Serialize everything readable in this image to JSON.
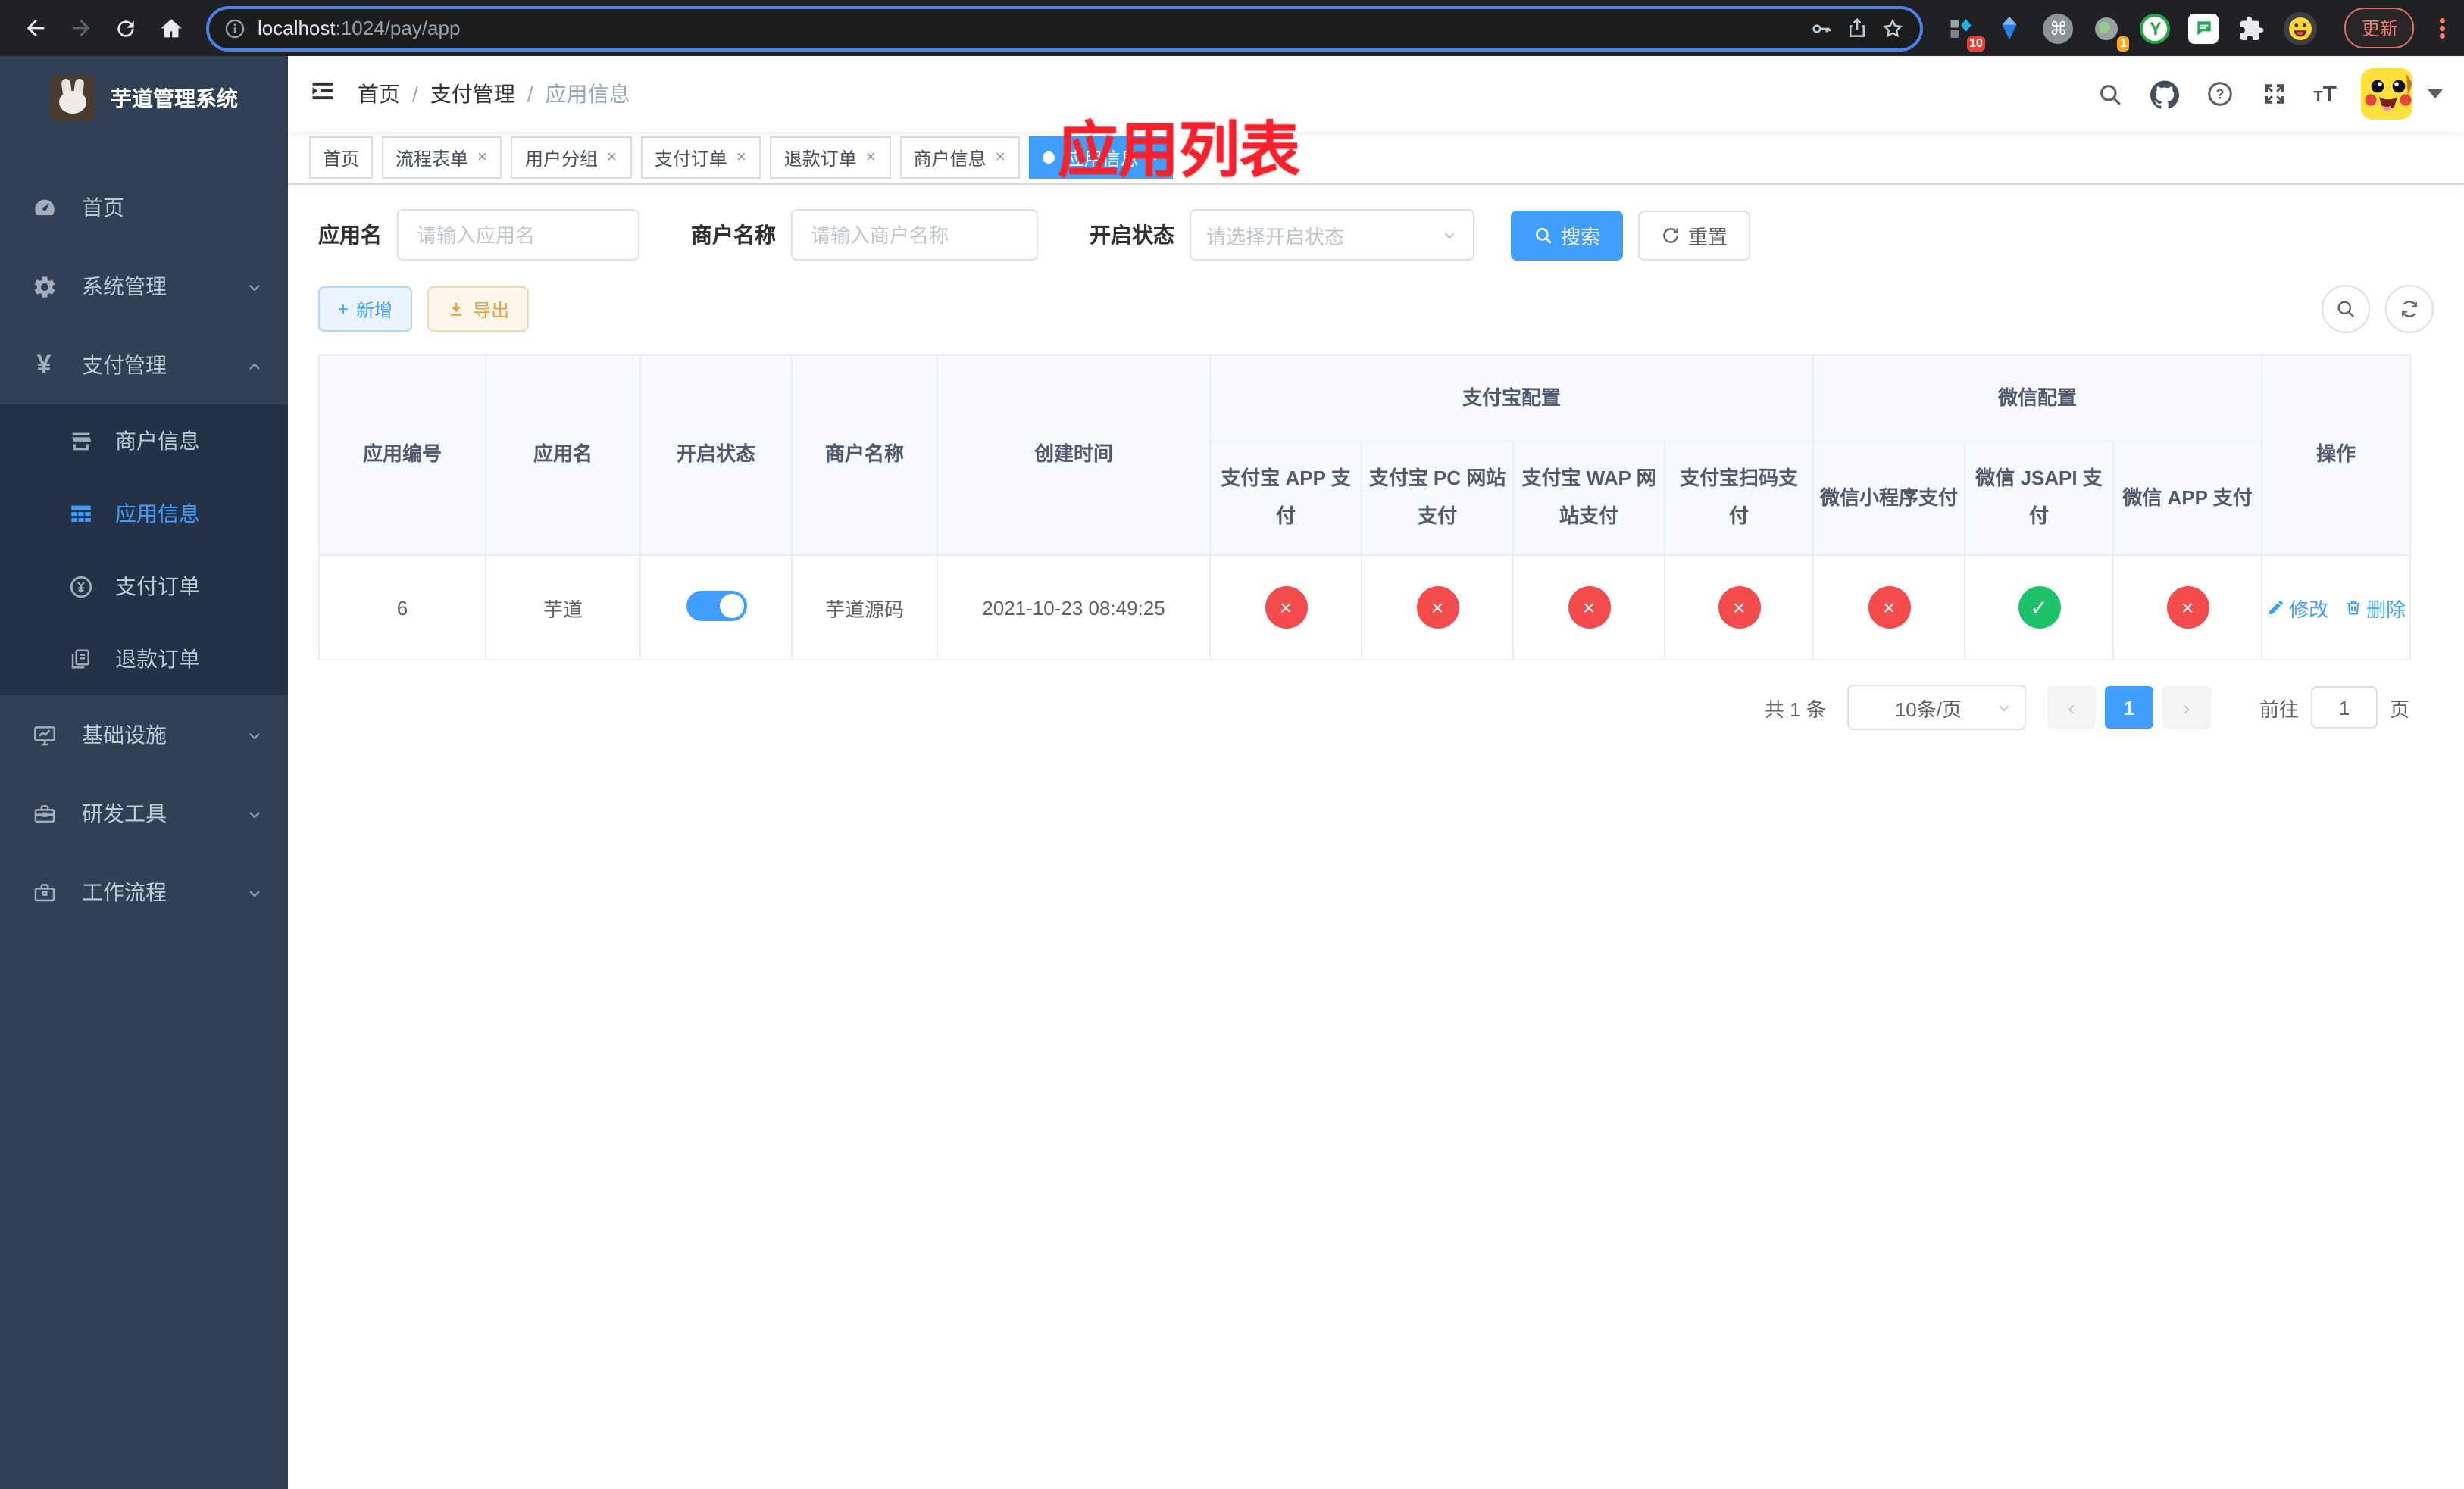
{
  "browser": {
    "url": {
      "host": "localhost",
      "rest": ":1024/pay/app"
    },
    "update_label": "更新",
    "ext_badge_tasks": "10",
    "ext_badge_one": "1",
    "ext_y_label": "Y"
  },
  "icons": {
    "plus": "+",
    "close": "×",
    "check": "✓",
    "cross": "×",
    "command": "⌘",
    "text_large": "T",
    "text_small": "T",
    "prev_arrow": "‹",
    "next_arrow": "›",
    "question": "?"
  },
  "colors": {
    "primary": "#409eff",
    "success": "#1ec26b",
    "danger": "#f44c4c",
    "warning": "#e6a23c",
    "annotation_red": "#f5222d",
    "sidebar_bg": "#304156",
    "submenu_bg": "#233246"
  },
  "sidebar": {
    "title": "芋道管理系统",
    "menu": [
      {
        "label": "首页"
      },
      {
        "label": "系统管理"
      },
      {
        "label": "支付管理"
      }
    ],
    "submenu": [
      {
        "label": "商户信息"
      },
      {
        "label": "应用信息"
      },
      {
        "label": "支付订单"
      },
      {
        "label": "退款订单"
      }
    ],
    "menu_bottom": [
      {
        "label": "基础设施"
      },
      {
        "label": "研发工具"
      },
      {
        "label": "工作流程"
      }
    ]
  },
  "breadcrumb": {
    "items": [
      "首页",
      "支付管理",
      "应用信息"
    ],
    "separator": "/"
  },
  "annotation": {
    "title": "应用列表"
  },
  "tabs": [
    {
      "label": "首页"
    },
    {
      "label": "流程表单"
    },
    {
      "label": "用户分组"
    },
    {
      "label": "支付订单"
    },
    {
      "label": "退款订单"
    },
    {
      "label": "商户信息"
    },
    {
      "label": "应用信息"
    }
  ],
  "filters": {
    "app_name_label": "应用名",
    "app_name_placeholder": "请输入应用名",
    "merchant_label": "商户名称",
    "merchant_placeholder": "请输入商户名称",
    "status_label": "开启状态",
    "status_placeholder": "请选择开启状态",
    "search_label": "搜索",
    "reset_label": "重置"
  },
  "toolbar": {
    "add_label": "新增",
    "export_label": "导出"
  },
  "table": {
    "col_headers": [
      "应用编号",
      "应用名",
      "开启状态",
      "商户名称",
      "创建时间"
    ],
    "group_alipay": "支付宝配置",
    "group_wechat": "微信配置",
    "channel_headers": [
      "支付宝 APP 支付",
      "支付宝 PC 网站支付",
      "支付宝 WAP 网站支付",
      "支付宝扫码支付",
      "微信小程序支付",
      "微信 JSAPI 支付",
      "微信 APP 支付"
    ],
    "action_header": "操作",
    "row": {
      "id": "6",
      "name": "芋道",
      "enabled": true,
      "merchant": "芋道源码",
      "created_at": "2021-10-23 08:49:25",
      "channel_status": [
        false,
        false,
        false,
        false,
        false,
        true,
        false
      ]
    },
    "actions": {
      "edit": "修改",
      "delete": "删除"
    }
  },
  "pagination": {
    "total_label": "共 1 条",
    "page_size_label": "10条/页",
    "current_page": "1",
    "goto_label": "前往",
    "page_unit": "页",
    "page_input_value": "1"
  }
}
